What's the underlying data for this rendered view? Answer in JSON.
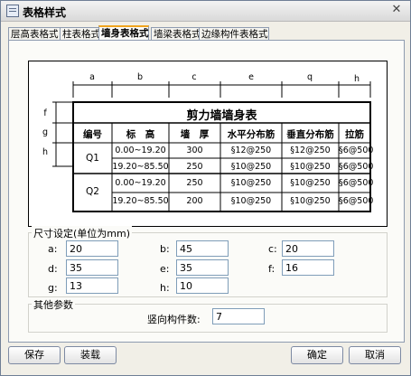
{
  "window": {
    "title": "表格样式"
  },
  "tabs": [
    {
      "label": "层高表格式"
    },
    {
      "label": "柱表格式"
    },
    {
      "label": "墙身表格式"
    },
    {
      "label": "墙梁表格式"
    },
    {
      "label": "边缘构件表格式"
    }
  ],
  "preview": {
    "col_letters": [
      "a",
      "b",
      "c",
      "e",
      "q",
      "h"
    ],
    "row_letters": [
      "f",
      "g",
      "h"
    ],
    "table_title": "剪力墙墙身表",
    "headers": [
      "编号",
      "标　高",
      "墙　厚",
      "水平分布筋",
      "垂直分布筋",
      "拉筋"
    ],
    "groups": [
      {
        "id": "Q1",
        "rows": [
          [
            "0.00~19.20",
            "300",
            "§12@250",
            "§12@250",
            "§6@500"
          ],
          [
            "19.20~85.50",
            "250",
            "§10@250",
            "§10@250",
            "§6@500"
          ]
        ]
      },
      {
        "id": "Q2",
        "rows": [
          [
            "0.00~19.20",
            "250",
            "§10@250",
            "§10@250",
            "§6@500"
          ],
          [
            "19.20~85.50",
            "200",
            "§10@250",
            "§10@250",
            "§6@500"
          ]
        ]
      }
    ]
  },
  "size_group": {
    "title": "尺寸设定(单位为mm)",
    "fields": [
      {
        "label": "a:",
        "value": "20"
      },
      {
        "label": "b:",
        "value": "45"
      },
      {
        "label": "c:",
        "value": "20"
      },
      {
        "label": "d:",
        "value": "35"
      },
      {
        "label": "e:",
        "value": "35"
      },
      {
        "label": "f:",
        "value": "16"
      },
      {
        "label": "g:",
        "value": "13"
      },
      {
        "label": "h:",
        "value": "10"
      }
    ]
  },
  "other_group": {
    "title": "其他参数",
    "vertical_count_label": "竖向构件数:",
    "vertical_count_value": "7"
  },
  "buttons": {
    "save": "保存",
    "load": "装载",
    "ok": "确定",
    "cancel": "取消"
  }
}
